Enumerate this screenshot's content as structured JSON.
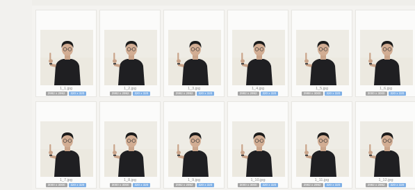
{
  "colors": {
    "background": "#f4f3f0",
    "card": "#fbfbfa",
    "original_badge": "#a6a6a6",
    "resized_badge": "#7fb0e6",
    "tshirt": "#1f1f22"
  },
  "thumbnails": [
    {
      "name": "1_1.jpg",
      "original": "2992 x 2992",
      "resized": "320 x 320"
    },
    {
      "name": "1_2.jpg",
      "original": "2992 x 2992",
      "resized": "320 x 320"
    },
    {
      "name": "1_3.jpg",
      "original": "2992 x 2992",
      "resized": "320 x 320"
    },
    {
      "name": "1_4.jpg",
      "original": "2992 x 2992",
      "resized": "320 x 320"
    },
    {
      "name": "1_5.jpg",
      "original": "2988 x 3000",
      "resized": "320 x 320"
    },
    {
      "name": "1_6.jpg",
      "original": "3000 x 3000",
      "resized": "320 x 320"
    },
    {
      "name": "1_7.jpg",
      "original": "3000 x 3000",
      "resized": "320 x 320"
    },
    {
      "name": "1_8.jpg",
      "original": "3000 x 3000",
      "resized": "320 x 320"
    },
    {
      "name": "1_9.jpg",
      "original": "2992 x 2992",
      "resized": "320 x 320"
    },
    {
      "name": "1_10.jpg",
      "original": "3000 x 3000",
      "resized": "320 x 320"
    },
    {
      "name": "1_11.jpg",
      "original": "2992 x 2992",
      "resized": "320 x 320"
    },
    {
      "name": "1_12.jpg",
      "original": "2992 x 2992",
      "resized": "320 x 320"
    }
  ]
}
